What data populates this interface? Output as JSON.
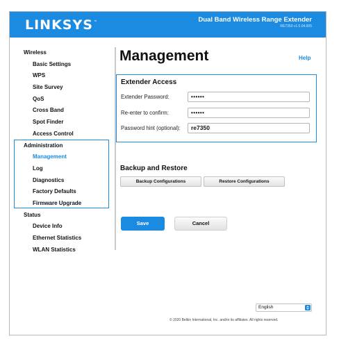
{
  "header": {
    "logo": "LINKSYS",
    "logo_tm": "™",
    "product": "Dual Band Wireless Range Extender",
    "version": "RE7350 v1.0.04.005"
  },
  "sidebar": {
    "wireless": {
      "label": "Wireless",
      "items": [
        "Basic Settings",
        "WPS",
        "Site Survey",
        "QoS",
        "Cross Band",
        "Spot Finder",
        "Access Control"
      ]
    },
    "administration": {
      "label": "Administration",
      "items": [
        "Management",
        "Log",
        "Diagnostics",
        "Factory Defaults",
        "Firmware Upgrade"
      ],
      "active": "Management"
    },
    "status": {
      "label": "Status",
      "items": [
        "Device Info",
        "Ethernet Statistics",
        "WLAN Statistics"
      ]
    }
  },
  "main": {
    "title": "Management",
    "help": "Help",
    "extender_access": {
      "title": "Extender Access",
      "password_label": "Extender Password:",
      "password_value": "••••••",
      "confirm_label": "Re-enter to confirm:",
      "confirm_value": "••••••",
      "hint_label": "Password hint (optional):",
      "hint_value": "re7350"
    },
    "backup": {
      "title": "Backup and Restore",
      "backup_button": "Backup Configurations",
      "restore_button": "Restore Configurations"
    },
    "save_button": "Save",
    "cancel_button": "Cancel"
  },
  "footer": {
    "language": "English",
    "copyright": "© 2020 Belkin International, Inc. and/or its affiliates. All rights reserved."
  },
  "colors": {
    "accent": "#1a8be0"
  }
}
